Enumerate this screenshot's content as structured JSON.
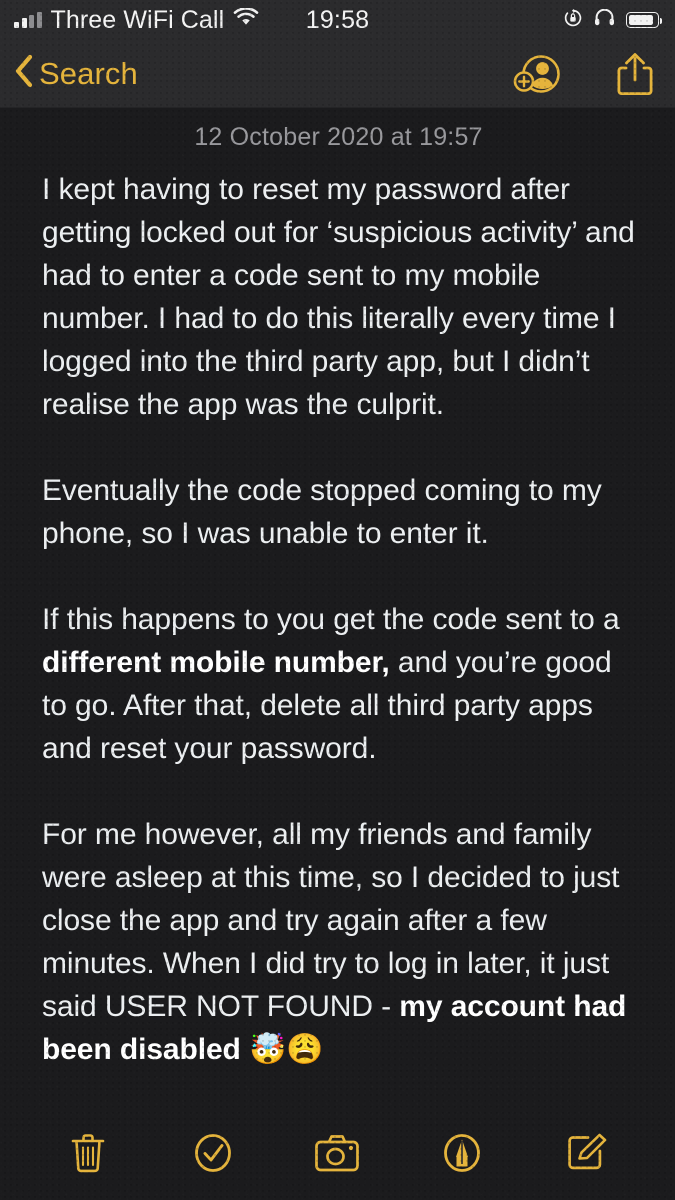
{
  "accent_color": "#E5B43C",
  "background_color": "#1B1B1D",
  "navbar_color": "#2B2B2D",
  "text_color": "#ECEFF1",
  "status_bar": {
    "carrier": "Three WiFi Call",
    "time": "19:58",
    "signal_icon": "signal-bars-icon",
    "wifi_icon": "wifi-icon",
    "rotation_lock_icon": "rotation-lock-icon",
    "headphones_icon": "headphones-icon",
    "battery_icon": "battery-icon",
    "battery_level_percent": 88,
    "signal_bars_filled": 2,
    "signal_bars_total": 4
  },
  "navbar": {
    "back_label": "Search",
    "back_icon": "chevron-left-icon",
    "add_person_icon": "add-person-icon",
    "share_icon": "share-icon"
  },
  "note": {
    "date": "12 October 2020 at 19:57",
    "paragraphs": [
      {
        "id": "p1",
        "runs": [
          {
            "text": "I kept having to reset my password after getting locked out for ‘suspicious activity’ and had to enter a code sent to my mobile number. I had to do this literally every time I logged into the third party app, but I didn’t realise the app was the culprit.",
            "bold": false
          }
        ]
      },
      {
        "id": "p2",
        "runs": [
          {
            "text": "Eventually the code stopped coming to my phone, so I was unable to enter it.",
            "bold": false
          }
        ]
      },
      {
        "id": "p3",
        "runs": [
          {
            "text": "If this happens to you get the code sent to a ",
            "bold": false
          },
          {
            "text": "different mobile number,",
            "bold": true
          },
          {
            "text": " and you’re good to go. After that, delete all third party apps and reset your password.",
            "bold": false
          }
        ]
      },
      {
        "id": "p4",
        "runs": [
          {
            "text": "For me however, all my friends and family were asleep at this time, so I decided to just close the app and try again after a few minutes.  When I did try to log in later, it just said USER NOT FOUND - ",
            "bold": false
          },
          {
            "text": "my account had been disabled",
            "bold": true
          },
          {
            "text": " 🤯😩",
            "bold": false
          }
        ]
      }
    ]
  },
  "toolbar": {
    "items": [
      {
        "name": "delete-button",
        "icon": "trash-icon",
        "label": "Delete"
      },
      {
        "name": "checklist-button",
        "icon": "checkmark-circle-icon",
        "label": "Checklist"
      },
      {
        "name": "camera-button",
        "icon": "camera-icon",
        "label": "Camera"
      },
      {
        "name": "markup-button",
        "icon": "markup-pen-circle-icon",
        "label": "Markup"
      },
      {
        "name": "compose-button",
        "icon": "compose-icon",
        "label": "Compose"
      }
    ]
  }
}
